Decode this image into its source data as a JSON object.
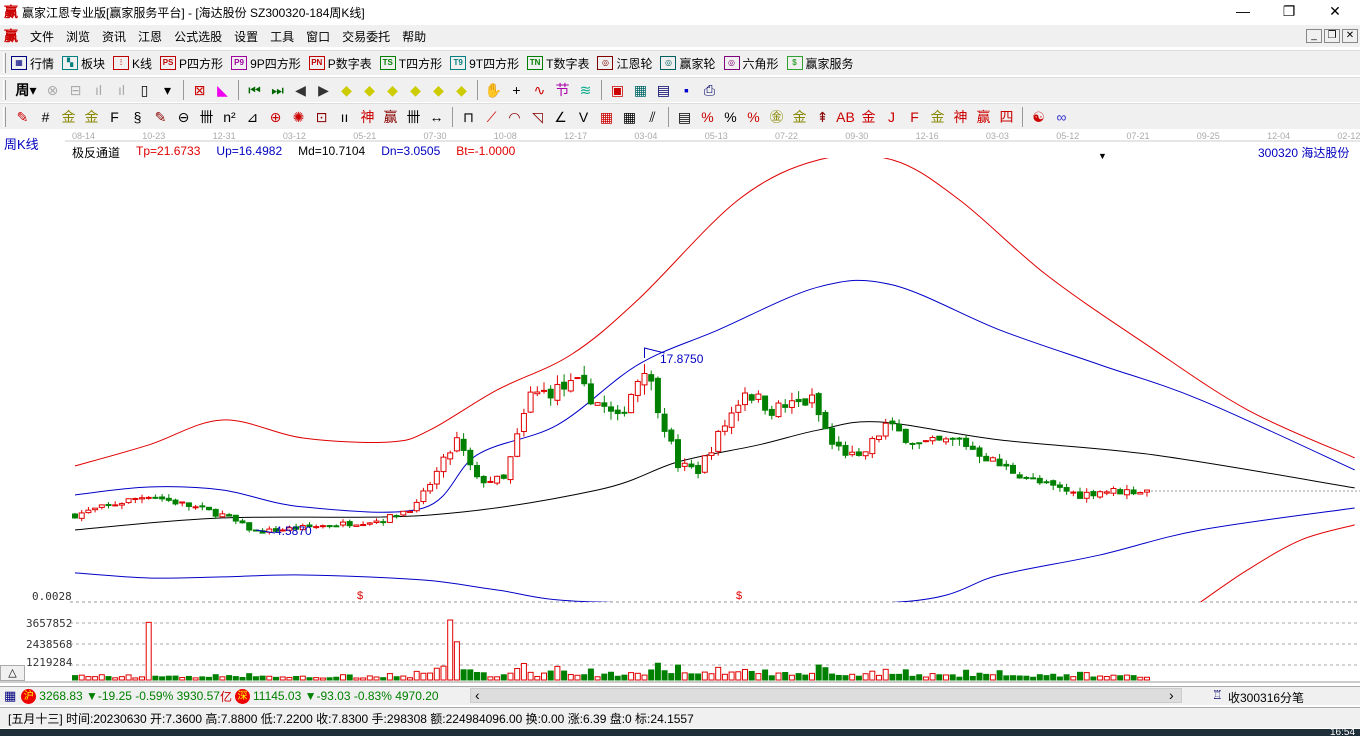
{
  "window": {
    "logo": "赢",
    "title": "赢家江恩专业版[赢家服务平台] - [海达股份  SZ300320-184周K线]",
    "minimize": "—",
    "maximize": "❐",
    "close": "✕"
  },
  "menu": {
    "logo": "赢",
    "items": [
      "文件",
      "浏览",
      "资讯",
      "江恩",
      "公式选股",
      "设置",
      "工具",
      "窗口",
      "交易委托",
      "帮助"
    ],
    "mdi": [
      "_",
      "❐",
      "✕"
    ]
  },
  "toolbar1": [
    {
      "icon": "▦",
      "label": "行情",
      "color": "#000080"
    },
    {
      "icon": "▚",
      "label": "板块",
      "color": "#008080"
    },
    {
      "icon": "⫶",
      "label": "K线",
      "color": "#c00000"
    },
    {
      "icon": "PS",
      "label": "P四方形",
      "color": "#c00000"
    },
    {
      "icon": "P9",
      "label": "9P四方形",
      "color": "#a000a0"
    },
    {
      "icon": "PN",
      "label": "P数字表",
      "color": "#c00000"
    },
    {
      "icon": "TS",
      "label": "T四方形",
      "color": "#008000"
    },
    {
      "icon": "T9",
      "label": "9T四方形",
      "color": "#008080"
    },
    {
      "icon": "TN",
      "label": "T数字表",
      "color": "#008000"
    },
    {
      "icon": "◎",
      "label": "江恩轮",
      "color": "#800000"
    },
    {
      "icon": "◎",
      "label": "赢家轮",
      "color": "#006060"
    },
    {
      "icon": "◎",
      "label": "六角形",
      "color": "#800080"
    },
    {
      "icon": "$",
      "label": "赢家服务",
      "color": "#30a030"
    }
  ],
  "toolbar2": {
    "period": "周",
    "icons": [
      [
        "chart-icon",
        "⊗",
        "#aaa"
      ],
      [
        "doc-icon",
        "⊟",
        "#aaa"
      ],
      [
        "bars3-icon",
        "ıl",
        "#aaa"
      ],
      [
        "bars9-icon",
        "ıl",
        "#aaa"
      ],
      [
        "candle-icon",
        "▯",
        "#000"
      ],
      [
        "dropdown-icon",
        "▾",
        "#000"
      ],
      [
        "gann-icon",
        "⊠",
        "#c00"
      ],
      [
        "color-icon",
        "◣",
        "#e0e"
      ],
      [
        "first-icon",
        "⏮",
        "#060"
      ],
      [
        "last-icon",
        "⏭",
        "#060"
      ],
      [
        "left-icon",
        "◀",
        "#333"
      ],
      [
        "right-icon",
        "▶",
        "#333"
      ],
      [
        "yellow-left-icon",
        "◆",
        "#cc0"
      ],
      [
        "yellow-right-icon",
        "◆",
        "#cc0"
      ],
      [
        "yellow-lr-icon",
        "◆",
        "#cc0"
      ],
      [
        "yellow-x-icon",
        "◆",
        "#cc0"
      ],
      [
        "yellow-y-icon",
        "◆",
        "#cc0"
      ],
      [
        "yellow-cross-icon",
        "◆",
        "#cc0"
      ],
      [
        "hand-icon",
        "✋",
        "#000"
      ],
      [
        "cross-icon",
        "+",
        "#000"
      ],
      [
        "wave-icon",
        "∿",
        "#c00"
      ],
      [
        "jie-icon",
        "节",
        "#a0a"
      ],
      [
        "ds-icon",
        "≋",
        "#0a8"
      ],
      [
        "calendar-icon",
        "▣",
        "#c00"
      ],
      [
        "calc-icon",
        "▦",
        "#066"
      ],
      [
        "list-icon",
        "▤",
        "#006"
      ],
      [
        "save-icon",
        "▪",
        "#00c"
      ],
      [
        "print-icon",
        "⎙",
        "#006"
      ]
    ]
  },
  "toolbar3": {
    "icons": [
      [
        "pen-icon",
        "✎",
        "#c00"
      ],
      [
        "grid-icon",
        "#",
        "#000"
      ],
      [
        "gold1-icon",
        "金",
        "#880"
      ],
      [
        "gold2-icon",
        "金",
        "#880"
      ],
      [
        "f-icon",
        "F",
        "#000"
      ],
      [
        "spiral-icon",
        "§",
        "#000"
      ],
      [
        "brush-icon",
        "✎",
        "#800"
      ],
      [
        "circle-icon",
        "⊖",
        "#000"
      ],
      [
        "tally-icon",
        "卌",
        "#000"
      ],
      [
        "n2-icon",
        "n²",
        "#000"
      ],
      [
        "angle-icon",
        "⊿",
        "#000"
      ],
      [
        "target-icon",
        "⊕",
        "#c00"
      ],
      [
        "star-icon",
        "✺",
        "#c00"
      ],
      [
        "square-icon",
        "⊡",
        "#800"
      ],
      [
        "lines-icon",
        "ıı",
        "#000"
      ],
      [
        "shen-icon",
        "神",
        "#c00"
      ],
      [
        "ying-icon",
        "赢",
        "#800"
      ],
      [
        "comb-icon",
        "卌",
        "#000"
      ],
      [
        "range-icon",
        "↔",
        "#000"
      ],
      [
        "box-icon",
        "⊓",
        "#000"
      ],
      [
        "fan-icon",
        "⟋",
        "#c00"
      ],
      [
        "arc-icon",
        "◠",
        "#800"
      ],
      [
        "fan2-icon",
        "◹",
        "#800"
      ],
      [
        "fan3-icon",
        "∠",
        "#000"
      ],
      [
        "v-icon",
        "V",
        "#000"
      ],
      [
        "grid2-icon",
        "▦",
        "#c00"
      ],
      [
        "grid3-icon",
        "▦",
        "#000"
      ],
      [
        "para-icon",
        "⫽",
        "#000"
      ],
      [
        "list-icon",
        "▤",
        "#000"
      ],
      [
        "pct1-icon",
        "%",
        "#c00"
      ],
      [
        "pct-icon",
        "%",
        "#000"
      ],
      [
        "pct2-icon",
        "%",
        "#c00"
      ],
      [
        "gold-circle-icon",
        "㊎",
        "#880"
      ],
      [
        "gold3-icon",
        "金",
        "#880"
      ],
      [
        "rocket-icon",
        "⇞",
        "#800"
      ],
      [
        "ab-icon",
        "AB",
        "#c00"
      ],
      [
        "gold4-icon",
        "金",
        "#c00"
      ],
      [
        "j-icon",
        "J",
        "#c00"
      ],
      [
        "f2-icon",
        "F",
        "#c00"
      ],
      [
        "gold5-icon",
        "金",
        "#880"
      ],
      [
        "shen2-icon",
        "神",
        "#c00"
      ],
      [
        "ying2-icon",
        "赢",
        "#c00"
      ],
      [
        "si-icon",
        "四",
        "#c00"
      ],
      [
        "taiji-icon",
        "☯",
        "#c00"
      ],
      [
        "infinity-icon",
        "∞",
        "#33c"
      ]
    ]
  },
  "chart": {
    "period_label": "周K线",
    "dates": [
      "08-14",
      "10-23",
      "12-31",
      "03-12",
      "05-21",
      "07-30",
      "10-08",
      "12-17",
      "03-04",
      "05-13",
      "07-22",
      "09-30",
      "12-16",
      "03-03",
      "05-12",
      "07-21",
      "09-25",
      "12-04",
      "02-12"
    ],
    "indicator": {
      "name": "极反通道",
      "tp": "Tp=21.6733",
      "up": "Up=16.4982",
      "md": "Md=10.7104",
      "dn": "Dn=3.0505",
      "bt": "Bt=-1.0000"
    },
    "stock": "300320  海达股份",
    "high_label": "17.8750",
    "low_label": "4.5870",
    "sub_label": "0.0028",
    "sub_markers": [
      "$",
      "$"
    ],
    "volume_ticks": [
      "3657852",
      "2438568",
      "1219284"
    ],
    "colors": {
      "up": "#e00000",
      "down": "#008000",
      "tp": "#e00000",
      "upline": "#0000c8",
      "md": "#000000",
      "dn": "#0000c8",
      "bt": "#e00000"
    },
    "price_path": [
      [
        0,
        5.75
      ],
      [
        11,
        7.3
      ],
      [
        22,
        5.75
      ],
      [
        27,
        4.43
      ],
      [
        46,
        5.36
      ],
      [
        51,
        6.5
      ],
      [
        57,
        11.5
      ],
      [
        60,
        8.45
      ],
      [
        64,
        8.45
      ],
      [
        68,
        15.0
      ],
      [
        75,
        15.8
      ],
      [
        81,
        13.1
      ],
      [
        85,
        17.3
      ],
      [
        90,
        9.6
      ],
      [
        93,
        9.2
      ],
      [
        100,
        15.4
      ],
      [
        104,
        13.9
      ],
      [
        110,
        14.6
      ],
      [
        113,
        11.2
      ],
      [
        117,
        10.0
      ],
      [
        121,
        12.7
      ],
      [
        126,
        11.2
      ],
      [
        132,
        11.5
      ],
      [
        138,
        9.6
      ],
      [
        144,
        8.2
      ],
      [
        150,
        7.3
      ],
      [
        153,
        7.6
      ],
      [
        160,
        7.6
      ]
    ],
    "lines": {
      "md": [
        [
          0,
          4.59
        ],
        [
          22,
          5.52
        ],
        [
          53,
          5.75
        ],
        [
          78,
          7.68
        ],
        [
          90,
          9.85
        ],
        [
          102,
          11.16
        ],
        [
          111,
          12.32
        ],
        [
          120,
          12.94
        ],
        [
          138,
          11.55
        ],
        [
          161,
          10.39
        ],
        [
          191,
          7.84
        ]
      ],
      "up": [
        [
          0,
          7.3
        ],
        [
          11,
          7.91
        ],
        [
          22,
          7.68
        ],
        [
          34,
          6.37
        ],
        [
          52,
          6.29
        ],
        [
          60,
          10.39
        ],
        [
          72,
          12.71
        ],
        [
          84,
          17.35
        ],
        [
          96,
          20.05
        ],
        [
          111,
          23.37
        ],
        [
          122,
          23.53
        ],
        [
          138,
          20.05
        ],
        [
          153,
          17.35
        ],
        [
          168,
          14.64
        ],
        [
          191,
          9.23
        ]
      ],
      "dn": [
        [
          0,
          1.27
        ],
        [
          11,
          0.88
        ],
        [
          22,
          0.96
        ],
        [
          34,
          1.11
        ],
        [
          52,
          0.72
        ],
        [
          63,
          -0.05
        ],
        [
          78,
          -0.98
        ],
        [
          123,
          -0.98
        ],
        [
          138,
          1.11
        ],
        [
          153,
          2.66
        ],
        [
          168,
          4.59
        ],
        [
          191,
          6.29
        ]
      ],
      "tp": [
        [
          0,
          9.54
        ],
        [
          11,
          11.16
        ],
        [
          22,
          13.09
        ],
        [
          34,
          11.7
        ],
        [
          47,
          11.39
        ],
        [
          53,
          12.32
        ],
        [
          63,
          15.41
        ],
        [
          74,
          18.12
        ],
        [
          84,
          22.37
        ],
        [
          99,
          30.1
        ],
        [
          111,
          33.19
        ],
        [
          122,
          33.19
        ],
        [
          132,
          30.1
        ],
        [
          145,
          24.3
        ],
        [
          160,
          18.89
        ],
        [
          175,
          13.87
        ],
        [
          191,
          10.16
        ]
      ],
      "bt": [
        [
          168,
          -0.98
        ],
        [
          175,
          1.5
        ],
        [
          183,
          3.82
        ],
        [
          191,
          4.98
        ]
      ]
    }
  },
  "status": {
    "sh_badge": "沪",
    "sh": "3268.83 ▼-19.25 -0.59% 3930.57",
    "yi": "亿",
    "sz_badge": "深",
    "sz": "11145.03 ▼-93.03 -0.83% 4970.20",
    "scroll_left": "‹",
    "scroll_right": "›",
    "right": "收300316分笔"
  },
  "info": "[五月十三] 时间:20230630 开:7.3600 高:7.8800 低:7.2200 收:7.8300 手:298308 额:224984096.00 换:0.00 涨:6.39 盘:0 标:24.1557",
  "taskbar": {
    "time": "16:54"
  }
}
